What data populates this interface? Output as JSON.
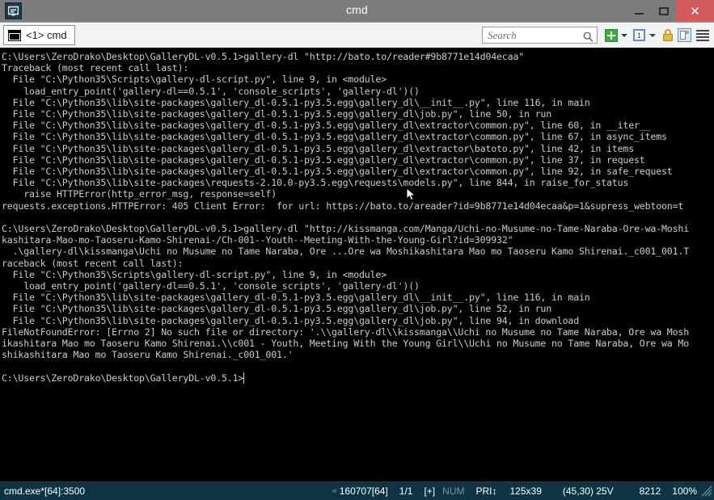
{
  "window": {
    "title": "cmd",
    "sysmenu_icon": "conemu-logo-icon",
    "minimize_label": "Minimize",
    "maximize_label": "Maximize",
    "close_label": "✕"
  },
  "tabbar": {
    "tabs": [
      {
        "label": "<1> cmd",
        "icon": "console-window-icon",
        "active": true
      }
    ],
    "toolbar": {
      "search_placeholder": "Search",
      "search_value": "",
      "search_icon": "search-icon",
      "new_console_icon": "green-plus-icon",
      "new_console_caret": "chevron-down-icon",
      "active_console_icon": "window-1-icon",
      "active_console_caret": "chevron-down-icon",
      "lock_icon": "lock-icon",
      "split_icon": "split-panes-icon",
      "menu_icon": "hamburger-menu-icon"
    }
  },
  "console": {
    "text": "C:\\Users\\ZeroDrako\\Desktop\\GalleryDL-v0.5.1>gallery-dl \"http://bato.to/reader#9b8771e14d04ecaa\"\nTraceback (most recent call last):\n  File \"C:\\Python35\\Scripts\\gallery-dl-script.py\", line 9, in <module>\n    load_entry_point('gallery-dl==0.5.1', 'console_scripts', 'gallery-dl')()\n  File \"C:\\Python35\\lib\\site-packages\\gallery_dl-0.5.1-py3.5.egg\\gallery_dl\\__init__.py\", line 116, in main\n  File \"C:\\Python35\\lib\\site-packages\\gallery_dl-0.5.1-py3.5.egg\\gallery_dl\\job.py\", line 50, in run\n  File \"C:\\Python35\\lib\\site-packages\\gallery_dl-0.5.1-py3.5.egg\\gallery_dl\\extractor\\common.py\", line 60, in __iter__\n  File \"C:\\Python35\\lib\\site-packages\\gallery_dl-0.5.1-py3.5.egg\\gallery_dl\\extractor\\common.py\", line 67, in async_items\n  File \"C:\\Python35\\lib\\site-packages\\gallery_dl-0.5.1-py3.5.egg\\gallery_dl\\extractor\\batoto.py\", line 42, in items\n  File \"C:\\Python35\\lib\\site-packages\\gallery_dl-0.5.1-py3.5.egg\\gallery_dl\\extractor\\common.py\", line 37, in request\n  File \"C:\\Python35\\lib\\site-packages\\gallery_dl-0.5.1-py3.5.egg\\gallery_dl\\extractor\\common.py\", line 92, in safe_request\n  File \"C:\\Python35\\lib\\site-packages\\requests-2.10.0-py3.5.egg\\requests\\models.py\", line 844, in raise_for_status\n    raise HTTPError(http_error_msg, response=self)\nrequests.exceptions.HTTPError: 405 Client Error:  for url: https://bato.to/areader?id=9b8771e14d04ecaa&p=1&supress_webtoon=t\n\nC:\\Users\\ZeroDrako\\Desktop\\GalleryDL-v0.5.1>gallery-dl \"http://kissmanga.com/Manga/Uchi-no-Musume-no-Tame-Naraba-Ore-wa-Moshi\nkashitara-Mao-mo-Taoseru-Kamo-Shirenai-/Ch-001--Youth--Meeting-With-the-Young-Girl?id=309932\"\n  .\\gallery-dl\\kissmanga\\Uchi no Musume no Tame Naraba, Ore ...Ore wa Moshikashitara Mao mo Taoseru Kamo Shirenai._c001_001.T\nraceback (most recent call last):\n  File \"C:\\Python35\\Scripts\\gallery-dl-script.py\", line 9, in <module>\n    load_entry_point('gallery-dl==0.5.1', 'console_scripts', 'gallery-dl')()\n  File \"C:\\Python35\\lib\\site-packages\\gallery_dl-0.5.1-py3.5.egg\\gallery_dl\\__init__.py\", line 116, in main\n  File \"C:\\Python35\\lib\\site-packages\\gallery_dl-0.5.1-py3.5.egg\\gallery_dl\\job.py\", line 52, in run\n  File \"C:\\Python35\\lib\\site-packages\\gallery_dl-0.5.1-py3.5.egg\\gallery_dl\\job.py\", line 94, in download\nFileNotFoundError: [Errno 2] No such file or directory: '.\\\\gallery-dl\\\\kissmanga\\\\Uchi no Musume no Tame Naraba, Ore wa Mosh\nikashitara Mao mo Taoseru Kamo Shirenai.\\\\c001 - Youth, Meeting With the Young Girl\\\\Uchi no Musume no Tame Naraba, Ore wa Mo\nshikashitara Mao mo Taoseru Kamo Shirenai._c001_001.'\n\nC:\\Users\\ZeroDrako\\Desktop\\GalleryDL-v0.5.1>",
    "prompt_cursor": "█",
    "fg_color": "#cccccc",
    "bg_color": "#000000",
    "mouse_pointer_icon": "mouse-arrow-cursor"
  },
  "statusbar": {
    "process": "cmd.exe*[64]:3500",
    "version_marker": "«",
    "build": "160707[64]",
    "tab_index": "1/1",
    "insert_mode": "[+]",
    "num_lock": "NUM",
    "priority": "PRI↕",
    "console_size": "125x39",
    "cursor_pos": "(45,30) 25V",
    "scroll_buffer": "8212",
    "zoom": "100%",
    "resize_grip_icon": "resize-grip-icon",
    "bg_color": "#0d3345"
  }
}
